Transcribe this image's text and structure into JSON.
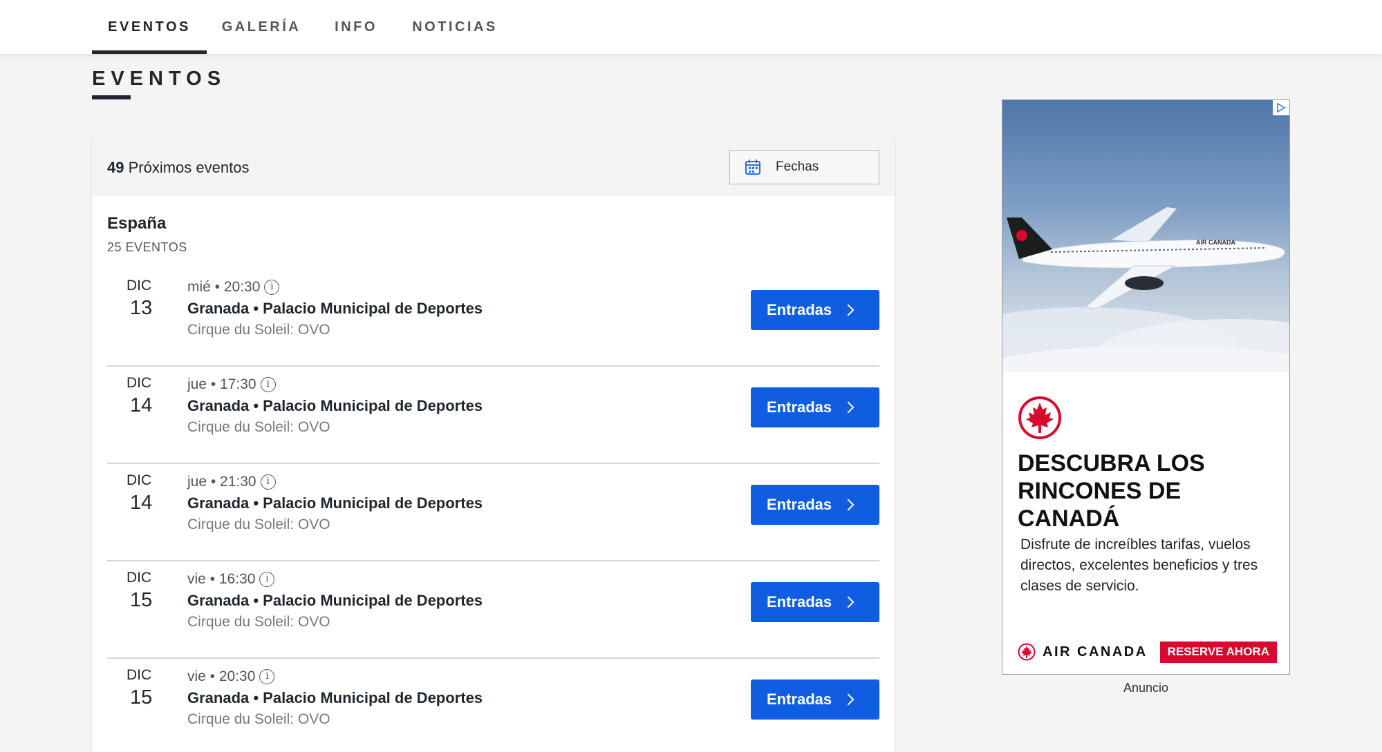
{
  "nav": {
    "tabs": [
      {
        "label": "EVENTOS",
        "active": true
      },
      {
        "label": "GALERÍA",
        "active": false
      },
      {
        "label": "INFO",
        "active": false
      },
      {
        "label": "NOTICIAS",
        "active": false
      }
    ]
  },
  "section": {
    "title": "EVENTOS"
  },
  "events_panel": {
    "count": "49",
    "count_label": "Próximos eventos",
    "dates_button": {
      "label": "Fechas",
      "icon": "calendar-icon"
    },
    "country": "España",
    "country_count": "25 EVENTOS",
    "events": [
      {
        "month": "DIC",
        "day": "13",
        "time": "mié • 20:30",
        "venue": "Granada • Palacio Municipal de Deportes",
        "show": "Cirque du Soleil: OVO",
        "button": "Entradas"
      },
      {
        "month": "DIC",
        "day": "14",
        "time": "jue • 17:30",
        "venue": "Granada • Palacio Municipal de Deportes",
        "show": "Cirque du Soleil: OVO",
        "button": "Entradas"
      },
      {
        "month": "DIC",
        "day": "14",
        "time": "jue • 21:30",
        "venue": "Granada • Palacio Municipal de Deportes",
        "show": "Cirque du Soleil: OVO",
        "button": "Entradas"
      },
      {
        "month": "DIC",
        "day": "15",
        "time": "vie • 16:30",
        "venue": "Granada • Palacio Municipal de Deportes",
        "show": "Cirque du Soleil: OVO",
        "button": "Entradas"
      },
      {
        "month": "DIC",
        "day": "15",
        "time": "vie • 20:30",
        "venue": "Granada • Palacio Municipal de Deportes",
        "show": "Cirque du Soleil: OVO",
        "button": "Entradas"
      }
    ]
  },
  "ad": {
    "plane_livery": "AIR CANADA",
    "headline_lines": [
      "DESCUBRA LOS",
      "RINCONES DE",
      "CANADÁ"
    ],
    "body": "Disfrute de increíbles tarifas, vuelos directos, excelentes beneficios y tres clases de servicio.",
    "brand": "AIR CANADA",
    "cta": "RESERVE AHORA",
    "label": "Anuncio"
  },
  "colors": {
    "primary_button": "#0f5de0",
    "ad_red": "#d8092e",
    "text_dark": "#1f262d",
    "page_bg": "#f4f4f4"
  }
}
